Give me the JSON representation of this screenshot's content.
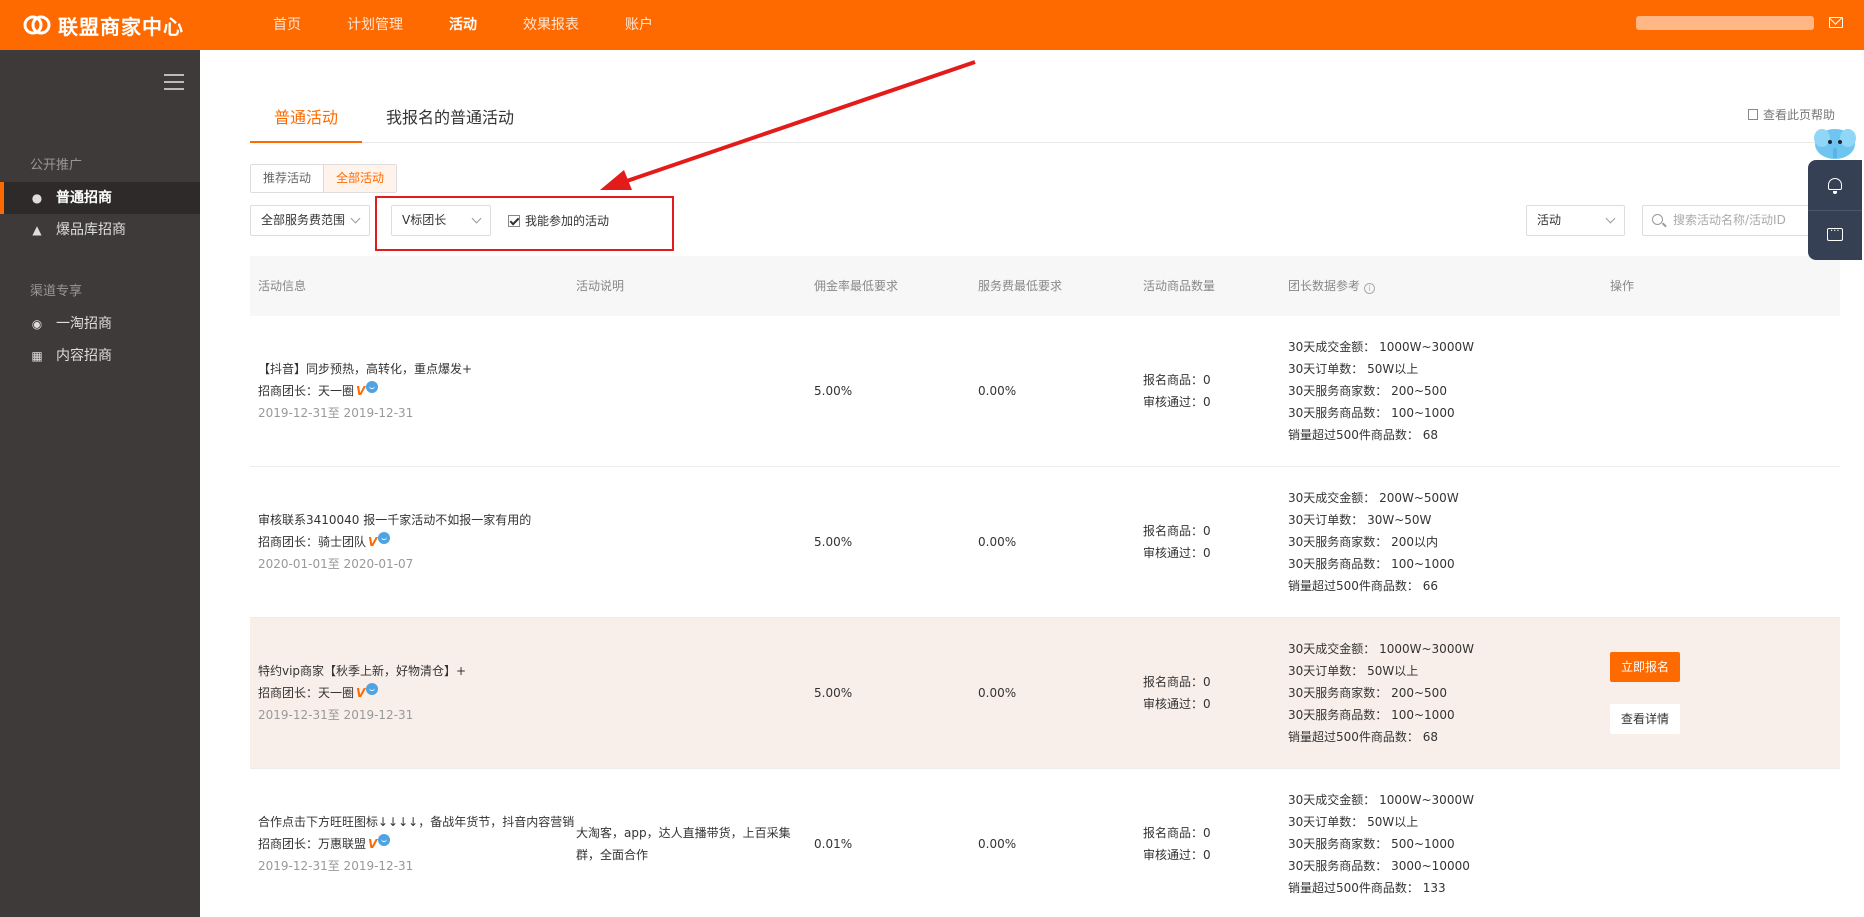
{
  "app": {
    "title": "联盟商家中心",
    "brand_color": "#ff6a00"
  },
  "topnav": [
    "首页",
    "计划管理",
    "活动",
    "效果报表",
    "账户"
  ],
  "sidebar": {
    "group1": "公开推广",
    "items1": [
      "普通招商",
      "爆品库招商"
    ],
    "group2": "渠道专享",
    "items2": [
      "一淘招商",
      "内容招商"
    ]
  },
  "tabs": [
    "普通活动",
    "我报名的普通活动"
  ],
  "help": "查看此页帮助",
  "seg": [
    "推荐活动",
    "全部活动"
  ],
  "filters": {
    "service_range": "全部服务费范围",
    "v_tag": "V标团长",
    "checkbox": "我能参加的活动",
    "type": "活动",
    "search_placeholder": "搜索活动名称/活动ID"
  },
  "table": {
    "headers": [
      "活动信息",
      "活动说明",
      "佣金率最低要求",
      "服务费最低要求",
      "活动商品数量",
      "团长数据参考",
      "操作"
    ],
    "rows": [
      {
        "title": "【抖音】同步预热，高转化，重点爆发+",
        "leader_label": "招商团长：",
        "leader": "天一圈",
        "dates": "2019-12-31至 2019-12-31",
        "desc1": "",
        "desc2": "",
        "commission": "5.00%",
        "service_fee": "0.00%",
        "signed": "报名商品：0",
        "approved": "审核通过：0",
        "stats": [
          "30天成交金额： 1000W~3000W",
          "30天订单数： 50W以上",
          "30天服务商家数： 200~500",
          "30天服务商品数： 100~1000",
          "销量超过500件商品数： 68"
        ]
      },
      {
        "title": "审核联系3410040 报一千家活动不如报一家有用的",
        "leader_label": "招商团长：",
        "leader": "骑士团队",
        "dates": "2020-01-01至 2020-01-07",
        "desc1": "",
        "desc2": "",
        "commission": "5.00%",
        "service_fee": "0.00%",
        "signed": "报名商品：0",
        "approved": "审核通过：0",
        "stats": [
          "30天成交金额： 200W~500W",
          "30天订单数： 30W~50W",
          "30天服务商家数： 200以内",
          "30天服务商品数： 100~1000",
          "销量超过500件商品数： 66"
        ]
      },
      {
        "title": "特约vip商家【秋季上新，好物清仓】+",
        "leader_label": "招商团长：",
        "leader": "天一圈",
        "dates": "2019-12-31至 2019-12-31",
        "desc1": "",
        "desc2": "",
        "commission": "5.00%",
        "service_fee": "0.00%",
        "signed": "报名商品：0",
        "approved": "审核通过：0",
        "stats": [
          "30天成交金额： 1000W~3000W",
          "30天订单数： 50W以上",
          "30天服务商家数： 200~500",
          "30天服务商品数： 100~1000",
          "销量超过500件商品数： 68"
        ],
        "action_primary": "立即报名",
        "action_secondary": "查看详情"
      },
      {
        "title": "合作点击下方旺旺图标↓↓↓↓，备战年货节，抖音内容营销",
        "leader_label": "招商团长：",
        "leader": "万惠联盟",
        "dates": "2019-12-31至 2019-12-31",
        "desc1": "大淘客，app，达人直播带货，上百采集",
        "desc2": "群，全面合作",
        "commission": "0.01%",
        "service_fee": "0.00%",
        "signed": "报名商品：0",
        "approved": "审核通过：0",
        "stats": [
          "30天成交金额： 1000W~3000W",
          "30天订单数： 50W以上",
          "30天服务商家数： 500~1000",
          "30天服务商品数： 3000~10000",
          "销量超过500件商品数： 133"
        ]
      }
    ]
  },
  "annotation": {
    "color": "#e31b1b"
  }
}
